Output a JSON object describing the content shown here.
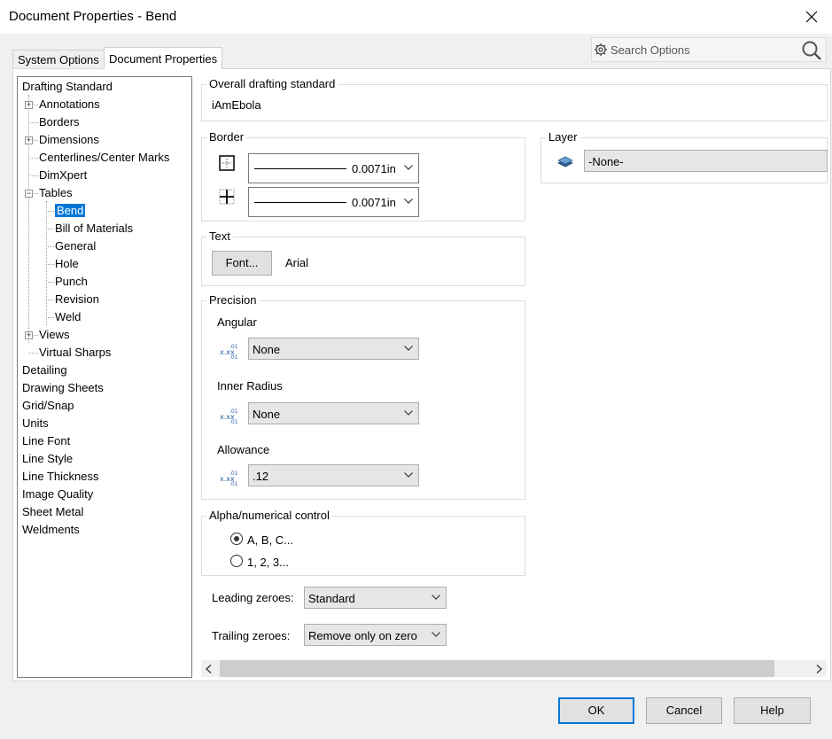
{
  "window": {
    "title": "Document Properties - Bend"
  },
  "tabs": [
    {
      "label": "System Options",
      "active": false
    },
    {
      "label": "Document Properties",
      "active": true
    }
  ],
  "search": {
    "placeholder": "Search Options"
  },
  "tree": {
    "items": [
      {
        "label": "Drafting Standard",
        "level": 0,
        "expander": ""
      },
      {
        "label": "Annotations",
        "level": 1,
        "expander": "+"
      },
      {
        "label": "Borders",
        "level": 1,
        "expander": ""
      },
      {
        "label": "Dimensions",
        "level": 1,
        "expander": "+"
      },
      {
        "label": "Centerlines/Center Marks",
        "level": 1,
        "expander": ""
      },
      {
        "label": "DimXpert",
        "level": 1,
        "expander": ""
      },
      {
        "label": "Tables",
        "level": 1,
        "expander": "-"
      },
      {
        "label": "Bend",
        "level": 2,
        "expander": "",
        "selected": true
      },
      {
        "label": "Bill of Materials",
        "level": 2,
        "expander": ""
      },
      {
        "label": "General",
        "level": 2,
        "expander": ""
      },
      {
        "label": "Hole",
        "level": 2,
        "expander": ""
      },
      {
        "label": "Punch",
        "level": 2,
        "expander": ""
      },
      {
        "label": "Revision",
        "level": 2,
        "expander": ""
      },
      {
        "label": "Weld",
        "level": 2,
        "expander": ""
      },
      {
        "label": "Views",
        "level": 1,
        "expander": "+"
      },
      {
        "label": "Virtual Sharps",
        "level": 1,
        "expander": ""
      },
      {
        "label": "Detailing",
        "level": 0,
        "expander": ""
      },
      {
        "label": "Drawing Sheets",
        "level": 0,
        "expander": ""
      },
      {
        "label": "Grid/Snap",
        "level": 0,
        "expander": ""
      },
      {
        "label": "Units",
        "level": 0,
        "expander": ""
      },
      {
        "label": "Line Font",
        "level": 0,
        "expander": ""
      },
      {
        "label": "Line Style",
        "level": 0,
        "expander": ""
      },
      {
        "label": "Line Thickness",
        "level": 0,
        "expander": ""
      },
      {
        "label": "Image Quality",
        "level": 0,
        "expander": ""
      },
      {
        "label": "Sheet Metal",
        "level": 0,
        "expander": ""
      },
      {
        "label": "Weldments",
        "level": 0,
        "expander": ""
      }
    ]
  },
  "overall": {
    "label": "Overall drafting standard",
    "value": "iAmEbola"
  },
  "border": {
    "label": "Border",
    "outer_value": "0.0071in",
    "inner_value": "0.0071in"
  },
  "layer": {
    "label": "Layer",
    "value": "-None-"
  },
  "text": {
    "label": "Text",
    "font_button": "Font...",
    "font_name": "Arial"
  },
  "precision": {
    "label": "Precision",
    "angular_label": "Angular",
    "angular_value": "None",
    "inner_radius_label": "Inner Radius",
    "inner_radius_value": "None",
    "allowance_label": "Allowance",
    "allowance_value": ".12"
  },
  "alpha": {
    "label": "Alpha/numerical control",
    "option_alpha": "A, B, C...",
    "option_numeric": "1, 2, 3...",
    "selected": "alpha"
  },
  "leading": {
    "label": "Leading zeroes:",
    "value": "Standard"
  },
  "trailing": {
    "label": "Trailing zeroes:",
    "value": "Remove only on zero"
  },
  "buttons": {
    "ok": "OK",
    "cancel": "Cancel",
    "help": "Help"
  },
  "colors": {
    "selection": "#0078d7",
    "layer_icon": "#4a7fb5"
  }
}
